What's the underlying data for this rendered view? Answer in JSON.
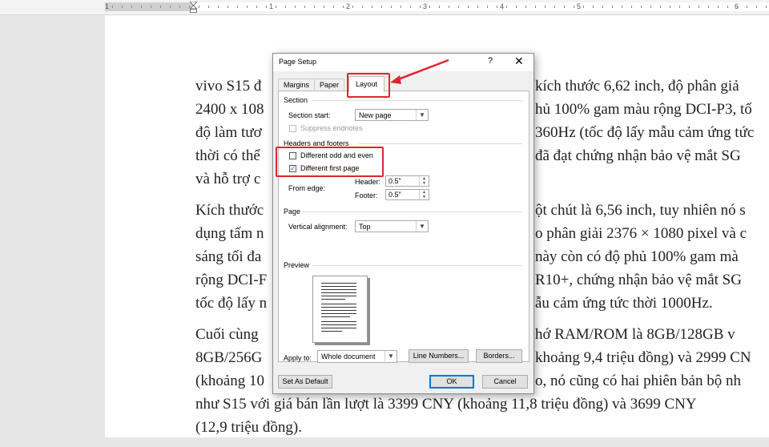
{
  "ruler": {
    "numbers": [
      "1",
      "1",
      "2",
      "3",
      "4",
      "5",
      "6"
    ]
  },
  "document": {
    "paragraphs": [
      [
        "vivo S15 đ",
        "2400 x 108",
        "độ làm tươ",
        "thời có thể",
        "và hỗ trợ c"
      ],
      [
        "Kích thước",
        "dụng tấm n",
        "sáng tối đa",
        "rộng DCI-F",
        "tốc độ lấy n"
      ],
      [
        "Cuối cùng",
        "8GB/256G",
        "(khoảng 10",
        "như S15 với giá bán lần lượt là 3399 CNY (khoảng 11,8 triệu đồng) và 3699 CNY",
        "(12,9 triệu đồng)."
      ]
    ],
    "right_fragments": [
      [
        "kích thước 6,62 inch, độ phân giả",
        "hủ 100% gam màu rộng DCI-P3, tố",
        "360Hz (tốc độ lấy mẫu cảm ứng tức",
        "đã đạt chứng nhận bảo vệ mắt SG",
        ""
      ],
      [
        "ột chút là 6,56 inch, tuy nhiên nó s",
        "o phân giải 2376 × 1080 pixel và c",
        "này còn có độ phủ 100% gam mà",
        "R10+, chứng nhận bảo vệ mắt SG",
        "ẫu cảm ứng tức thời 1000Hz."
      ],
      [
        "hớ RAM/ROM là 8GB/128GB v",
        "khoảng 9,4 triệu đồng) và 2999 CN",
        "o, nó cũng có hai phiên bản bộ nh",
        "",
        ""
      ]
    ]
  },
  "dialog": {
    "title": "Page Setup",
    "help": "?",
    "close": "✕",
    "tabs": [
      {
        "label": "Margins"
      },
      {
        "label": "Paper"
      },
      {
        "label": "Layout"
      }
    ],
    "section": {
      "heading": "Section",
      "start_label": "Section start:",
      "start_value": "New page",
      "suppress_label": "Suppress endnotes"
    },
    "headers_footers": {
      "heading": "Headers and footers",
      "odd_even_label": "Different odd and even",
      "odd_even_checked": false,
      "first_page_label": "Different first page",
      "first_page_checked": true,
      "from_edge_label": "From edge:",
      "header_label": "Header:",
      "header_value": "0.5\"",
      "footer_label": "Footer:",
      "footer_value": "0.5\""
    },
    "page": {
      "heading": "Page",
      "valign_label": "Vertical alignment:",
      "valign_value": "Top"
    },
    "preview": {
      "heading": "Preview"
    },
    "apply_to_label": "Apply to:",
    "apply_to_value": "Whole document",
    "line_numbers_button": "Line Numbers...",
    "borders_button": "Borders...",
    "set_default_button": "Set As Default",
    "ok_button": "OK",
    "cancel_button": "Cancel"
  },
  "colors": {
    "highlight": "#e0262d",
    "checkbox_check": "#1a6fc9",
    "default_button_border": "#0078d7"
  },
  "icons": {
    "dropdown": "chevron-down-icon",
    "spin": "spin-arrows-icon",
    "check": "checkmark-icon"
  }
}
